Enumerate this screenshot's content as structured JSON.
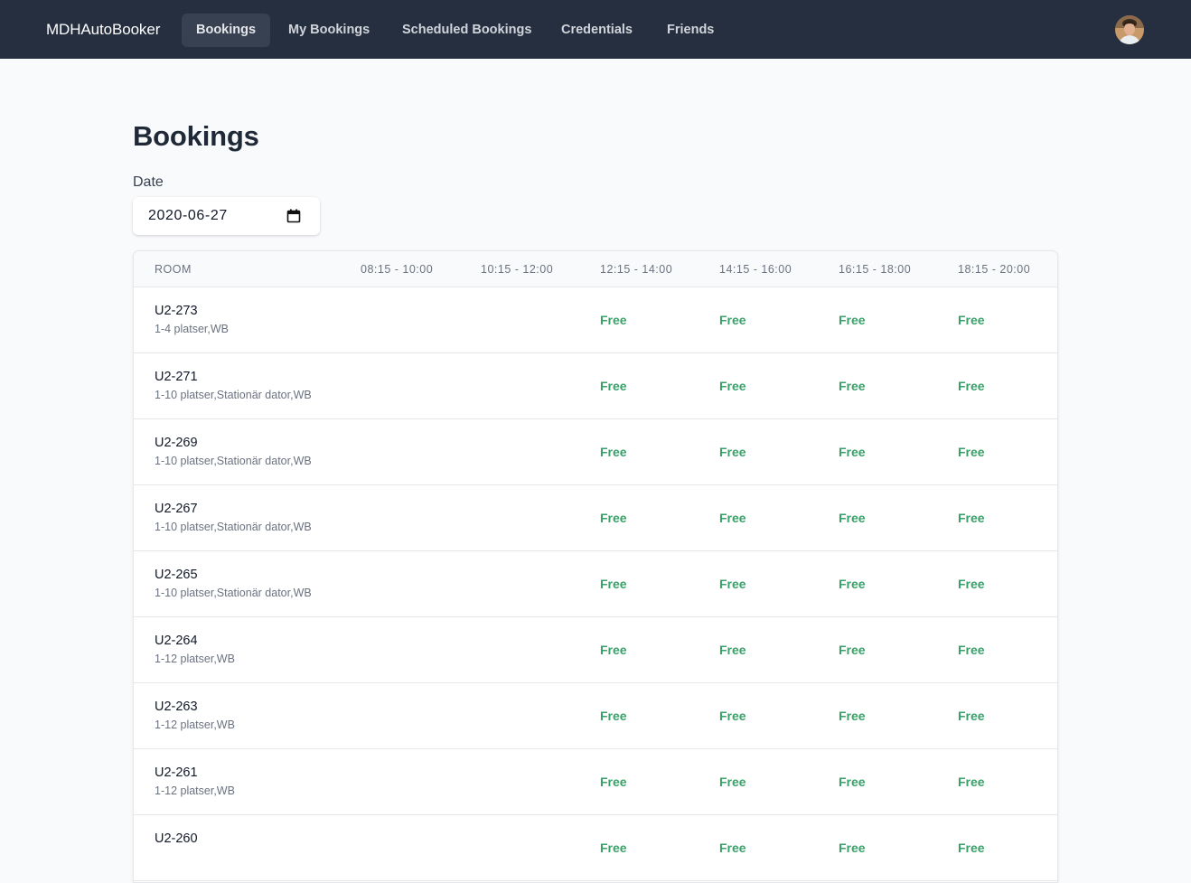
{
  "navbar": {
    "brand": "MDHAutoBooker",
    "links": [
      {
        "label": "Bookings",
        "active": true
      },
      {
        "label": "My Bookings",
        "active": false
      },
      {
        "label": "Scheduled Bookings",
        "active": false
      },
      {
        "label": "Credentials",
        "active": false
      },
      {
        "label": "Friends",
        "active": false
      }
    ],
    "avatar_icon": "user-avatar"
  },
  "page": {
    "title": "Bookings"
  },
  "date_picker": {
    "label": "Date",
    "value": "2020-06-27",
    "icon": "calendar-icon"
  },
  "table": {
    "columns": [
      "ROOM",
      "08:15 - 10:00",
      "10:15 - 12:00",
      "12:15 - 14:00",
      "14:15 - 16:00",
      "16:15 - 18:00",
      "18:15 - 20:00"
    ],
    "rows": [
      {
        "room": "U2-273",
        "desc": "1-4 platser,WB",
        "slots": [
          "",
          "",
          "Free",
          "Free",
          "Free",
          "Free"
        ]
      },
      {
        "room": "U2-271",
        "desc": "1-10 platser,Stationär dator,WB",
        "slots": [
          "",
          "",
          "Free",
          "Free",
          "Free",
          "Free"
        ]
      },
      {
        "room": "U2-269",
        "desc": "1-10 platser,Stationär dator,WB",
        "slots": [
          "",
          "",
          "Free",
          "Free",
          "Free",
          "Free"
        ]
      },
      {
        "room": "U2-267",
        "desc": "1-10 platser,Stationär dator,WB",
        "slots": [
          "",
          "",
          "Free",
          "Free",
          "Free",
          "Free"
        ]
      },
      {
        "room": "U2-265",
        "desc": "1-10 platser,Stationär dator,WB",
        "slots": [
          "",
          "",
          "Free",
          "Free",
          "Free",
          "Free"
        ]
      },
      {
        "room": "U2-264",
        "desc": "1-12 platser,WB",
        "slots": [
          "",
          "",
          "Free",
          "Free",
          "Free",
          "Free"
        ]
      },
      {
        "room": "U2-263",
        "desc": "1-12 platser,WB",
        "slots": [
          "",
          "",
          "Free",
          "Free",
          "Free",
          "Free"
        ]
      },
      {
        "room": "U2-261",
        "desc": "1-12 platser,WB",
        "slots": [
          "",
          "",
          "Free",
          "Free",
          "Free",
          "Free"
        ]
      },
      {
        "room": "U2-260",
        "desc": "",
        "slots": [
          "",
          "",
          "Free",
          "Free",
          "Free",
          "Free"
        ]
      }
    ]
  },
  "colors": {
    "navbar_bg": "#252f3f",
    "free_text": "#38a169",
    "page_bg": "#f9fafb"
  }
}
